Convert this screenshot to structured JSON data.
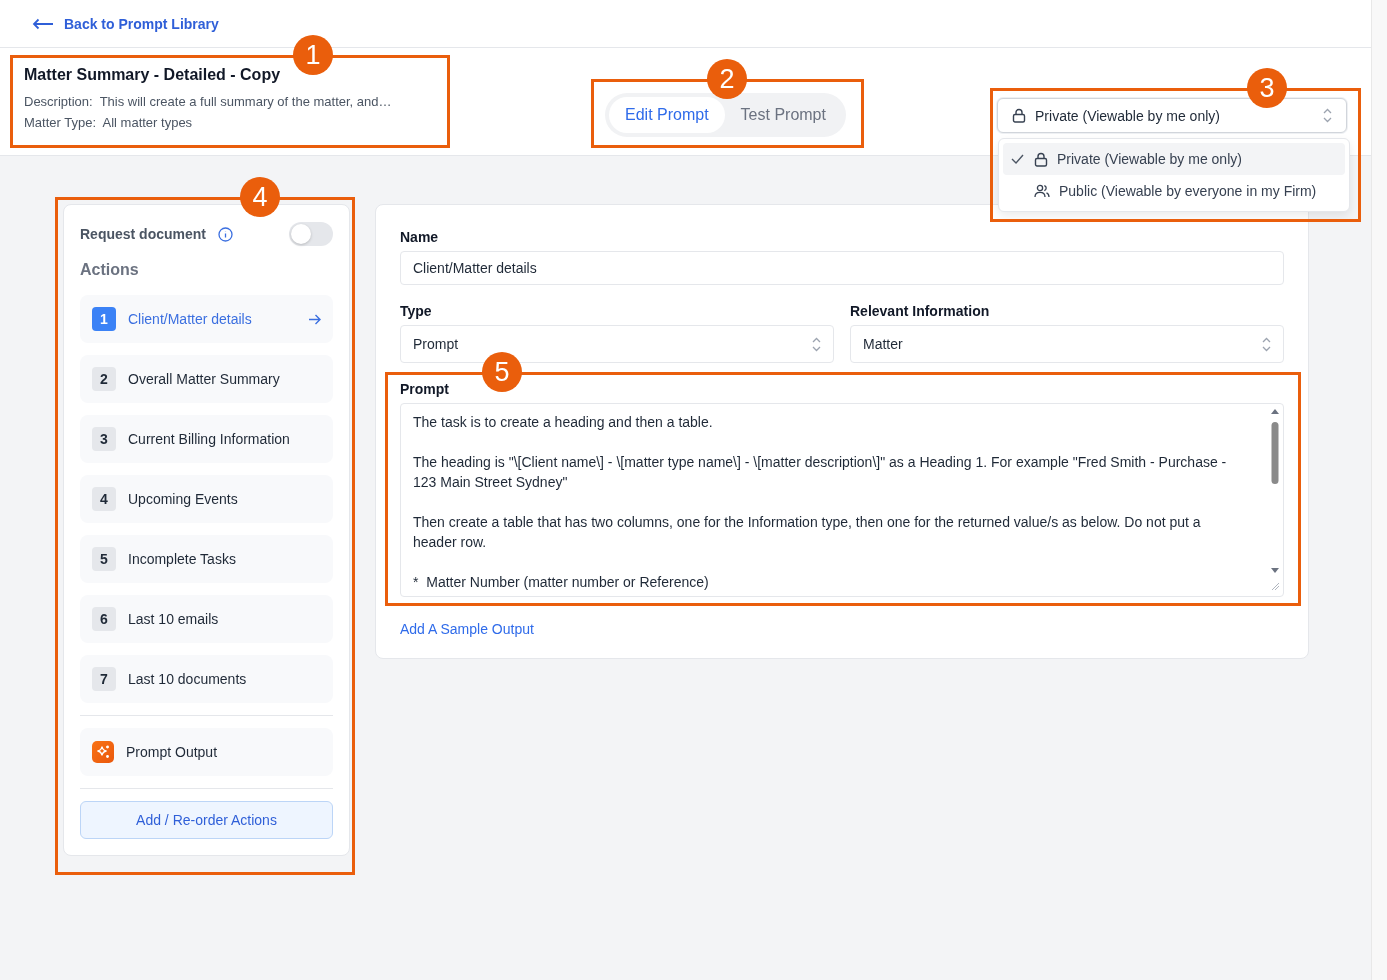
{
  "back_link": {
    "label": "Back to Prompt Library"
  },
  "prompt_info": {
    "title": "Matter Summary - Detailed - Copy",
    "description_label": "Description:",
    "description": "This will create a full summary of the matter, and…",
    "matter_type_label": "Matter Type:",
    "matter_type": "All matter types"
  },
  "mode_tabs": [
    {
      "label": "Edit Prompt",
      "selected": true
    },
    {
      "label": "Test Prompt",
      "selected": false
    }
  ],
  "visibility": {
    "value": "Private (Viewable by me only)",
    "expanded": true,
    "options": [
      {
        "label": "Private (Viewable by me only)",
        "kind": "lock",
        "selected": true
      },
      {
        "label": "Public (Viewable by everyone in my Firm)",
        "kind": "people",
        "selected": false
      }
    ]
  },
  "request_document": {
    "label": "Request document",
    "on": false
  },
  "actions": {
    "title": "Actions",
    "items": [
      {
        "number": "1",
        "label": "Client/Matter details",
        "selected": true
      },
      {
        "number": "2",
        "label": "Overall Matter Summary",
        "selected": false
      },
      {
        "number": "3",
        "label": "Current Billing Information",
        "selected": false
      },
      {
        "number": "4",
        "label": "Upcoming Events",
        "selected": false
      },
      {
        "number": "5",
        "label": "Incomplete Tasks",
        "selected": false
      },
      {
        "number": "6",
        "label": "Last 10 emails",
        "selected": false
      },
      {
        "number": "7",
        "label": "Last 10 documents",
        "selected": false
      }
    ],
    "output_label": "Prompt Output",
    "add_button": "Add / Re-order Actions"
  },
  "form": {
    "name_label": "Name",
    "name_value": "Client/Matter details",
    "type_label": "Type",
    "type_value": "Prompt",
    "info_label": "Relevant Information",
    "info_value": "Matter",
    "prompt_label": "Prompt",
    "prompt_lines": [
      "The task is to create a heading and then a table.",
      "The heading is \"\\[Client name\\] - \\[matter type name\\] - \\[matter description\\]\" as a Heading 1. For example \"Fred Smith - Purchase - 123 Main Street Sydney\"",
      "Then create a table that has two columns, one for the Information type, then one for the returned value/s as below. Do not put a header row.",
      "*  Matter Number (matter number or Reference)"
    ],
    "sample_link": "Add A Sample Output"
  },
  "annotations": [
    {
      "number": "1"
    },
    {
      "number": "2"
    },
    {
      "number": "3"
    },
    {
      "number": "4"
    },
    {
      "number": "5"
    }
  ]
}
